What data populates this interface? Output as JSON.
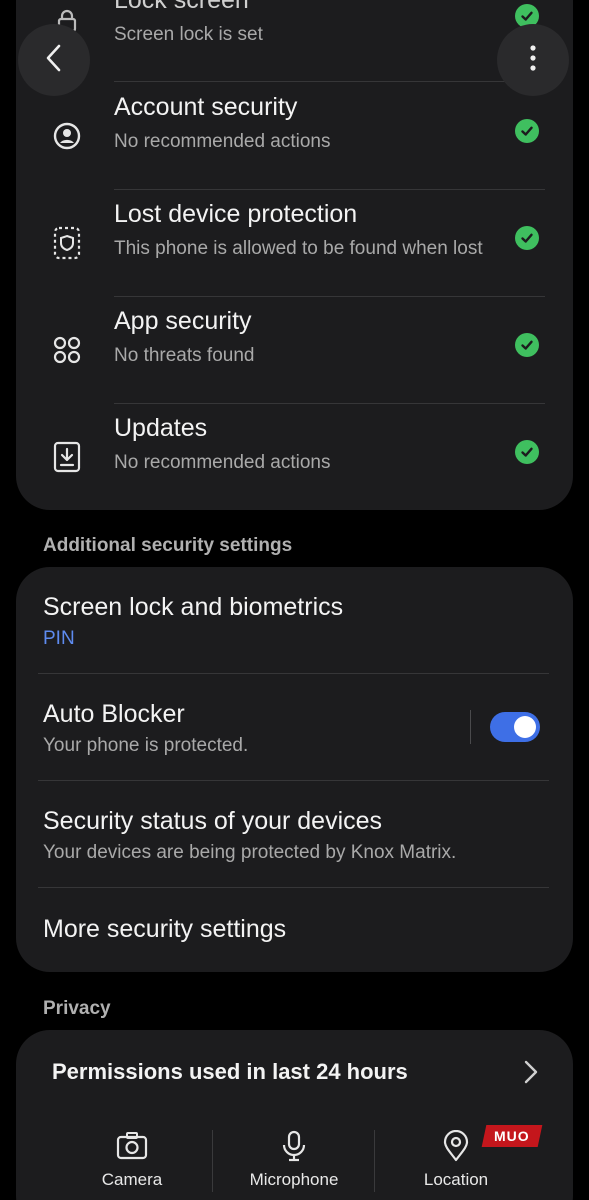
{
  "security_status": {
    "items": [
      {
        "title": "Lock screen",
        "subtitle": "Screen lock is set",
        "icon": "lock-icon",
        "status": "ok"
      },
      {
        "title": "Account security",
        "subtitle": "No recommended actions",
        "icon": "account-icon",
        "status": "ok"
      },
      {
        "title": "Lost device protection",
        "subtitle": "This phone is allowed to be found when lost",
        "icon": "lost-device-icon",
        "status": "ok"
      },
      {
        "title": "App security",
        "subtitle": "No threats found",
        "icon": "apps-icon",
        "status": "ok"
      },
      {
        "title": "Updates",
        "subtitle": "No recommended actions",
        "icon": "update-icon",
        "status": "ok"
      }
    ]
  },
  "additional": {
    "header": "Additional security settings",
    "items": [
      {
        "title": "Screen lock and biometrics",
        "subtitle": "PIN"
      },
      {
        "title": "Auto Blocker",
        "subtitle": "Your phone is protected.",
        "toggle_on": true
      },
      {
        "title": "Security status of your devices",
        "subtitle": "Your devices are being protected by Knox Matrix."
      },
      {
        "title": "More security settings"
      }
    ]
  },
  "privacy": {
    "header": "Privacy",
    "permissions_title": "Permissions used in last 24 hours",
    "permissions": [
      {
        "label": "Camera",
        "icon": "camera-icon"
      },
      {
        "label": "Microphone",
        "icon": "microphone-icon"
      },
      {
        "label": "Location",
        "icon": "location-icon"
      }
    ]
  },
  "watermark": "MUO",
  "colors": {
    "background": "#000000",
    "card": "#1c1c1e",
    "check_green": "#3fbf5f",
    "accent_blue": "#5e8bf0",
    "toggle_blue": "#3e6fe6"
  }
}
